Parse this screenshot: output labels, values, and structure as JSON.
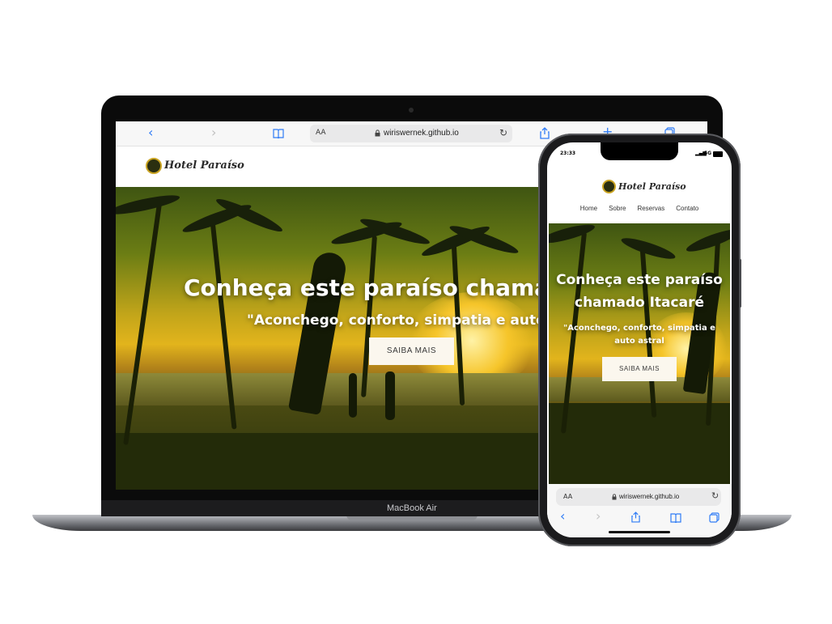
{
  "laptop": {
    "browser": {
      "address_aa": "AA",
      "url": "wiriswernek.github.io"
    },
    "site": {
      "logo_text": "Hotel Paraíso",
      "hero_title": "Conheça este paraíso chamado",
      "hero_subtitle": "\"Aconchego, conforto, simpatia e auto a",
      "cta_label": "SAIBA MAIS"
    },
    "model_label": "MacBook Air"
  },
  "phone": {
    "status": {
      "time": "23:33",
      "network": "5G"
    },
    "site": {
      "logo_text": "Hotel Paraíso",
      "nav": [
        "Home",
        "Sobre",
        "Reservas",
        "Contato"
      ],
      "hero_title_line1": "Conheça este paraíso",
      "hero_title_line2": "chamado Itacaré",
      "hero_subtitle_line1": "\"Aconchego, conforto, simpatia e",
      "hero_subtitle_line2": "auto astral",
      "cta_label": "SAIBA MAIS"
    },
    "browser": {
      "address_aa": "AA",
      "url": "wiriswernek.github.io"
    }
  },
  "icons": {
    "back": "chevron-left-icon",
    "forward": "chevron-right-icon",
    "bookmarks": "book-icon",
    "reload": "reload-icon",
    "share": "share-icon",
    "new_tab": "plus-icon",
    "tabs": "tabs-icon",
    "lock": "lock-icon"
  },
  "colors": {
    "accent_blue": "#2f7cf6",
    "cta_bg": "#fbf7ee"
  }
}
